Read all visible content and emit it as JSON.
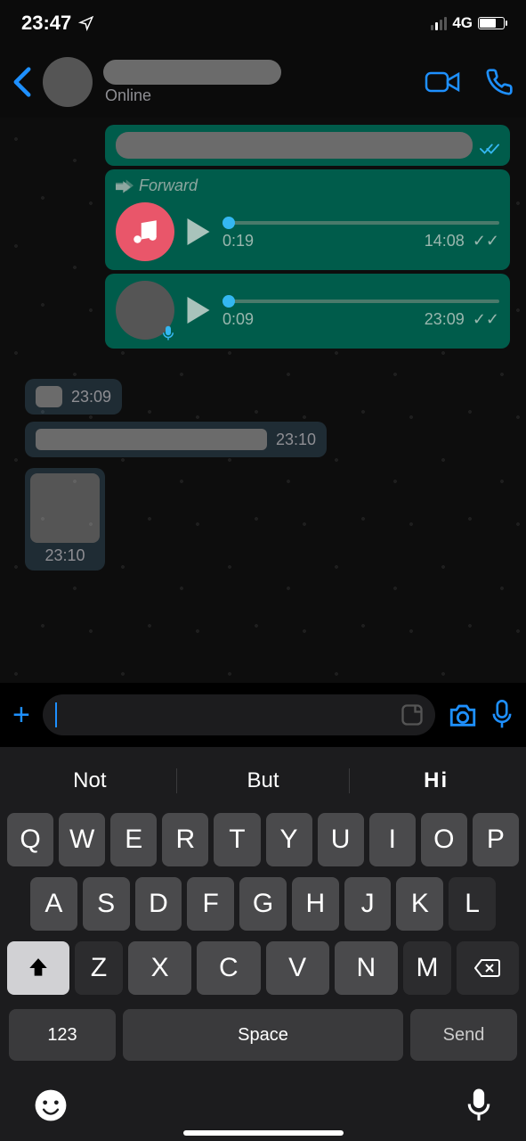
{
  "status": {
    "time": "23:47",
    "network": "4G"
  },
  "header": {
    "status_text": "Online"
  },
  "messages": {
    "forward_label": "Forward",
    "audio1": {
      "duration": "0:19",
      "timestamp": "14:08",
      "ticks": "✓✓"
    },
    "audio2": {
      "duration": "0:09",
      "timestamp": "23:09",
      "ticks": "✓✓"
    },
    "in1_ts": "23:09",
    "in2_ts": "23:10",
    "in3_ts": "23:10"
  },
  "suggestions": {
    "s1": "Not",
    "s2": "But",
    "s3": "Hi"
  },
  "keyboard": {
    "row1": [
      "Q",
      "W",
      "E",
      "R",
      "T",
      "Y",
      "U",
      "I",
      "O",
      "P"
    ],
    "row2": [
      "A",
      "S",
      "D",
      "F",
      "G",
      "H",
      "J",
      "K",
      "L"
    ],
    "row3": [
      "Z",
      "X",
      "C",
      "V",
      "N",
      "M"
    ],
    "num_label": "123",
    "space_label": "Space",
    "send_label": "Send"
  }
}
